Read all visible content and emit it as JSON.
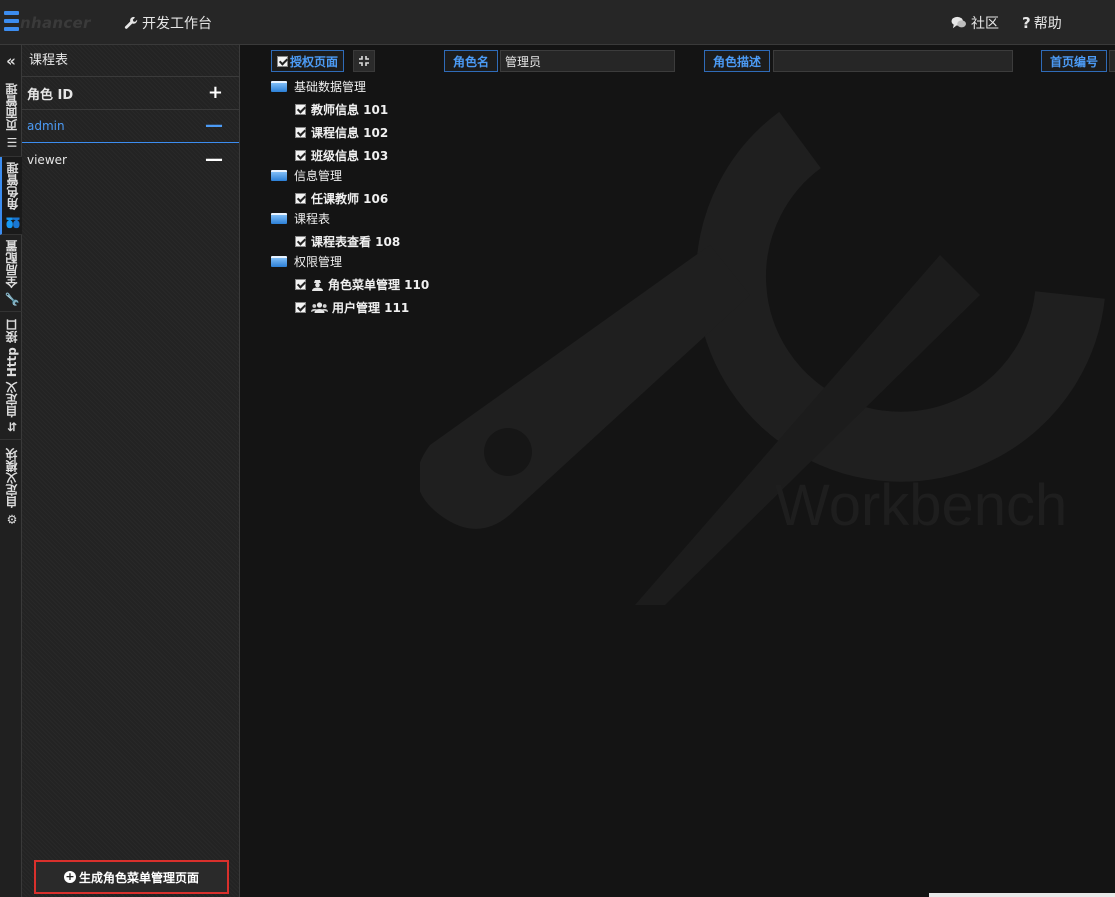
{
  "brand": {
    "logo_text": "nhancer"
  },
  "topbar": {
    "workbench_label": "开发工作台",
    "community_label": "社区",
    "help_label": "帮助"
  },
  "vtabs": [
    {
      "label": "页面管理",
      "icon": "list-icon"
    },
    {
      "label": "角色管理",
      "icon": "users-icon",
      "active": true
    },
    {
      "label": "全局配置",
      "icon": "wrench-icon"
    },
    {
      "label": "自定义 Http 接口",
      "icon": "arrows-icon"
    },
    {
      "label": "自定义模块",
      "icon": "cubes-icon"
    }
  ],
  "sidebar": {
    "title": "课程表",
    "header_label": "角色 ID",
    "roles": [
      {
        "id": "admin",
        "active": true
      },
      {
        "id": "viewer",
        "active": false
      }
    ],
    "generate_button_label": "生成角色菜单管理页面"
  },
  "toolbar": {
    "authorize_label": "授权页面",
    "role_name_label": "角色名",
    "role_name_value": "管理员",
    "role_desc_label": "角色描述",
    "role_desc_value": "",
    "home_no_label": "首页编号"
  },
  "tree": [
    {
      "type": "folder",
      "label": "基础数据管理"
    },
    {
      "type": "leaf",
      "label": "教师信息 101"
    },
    {
      "type": "leaf",
      "label": "课程信息 102"
    },
    {
      "type": "leaf",
      "label": "班级信息 103"
    },
    {
      "type": "folder",
      "label": "信息管理"
    },
    {
      "type": "leaf",
      "label": "任课教师 106"
    },
    {
      "type": "folder",
      "label": "课程表"
    },
    {
      "type": "leaf",
      "label": "课程表查看 108"
    },
    {
      "type": "folder",
      "label": "权限管理"
    },
    {
      "type": "leaf",
      "label": "角色菜单管理 110",
      "icon": "user-secret-icon"
    },
    {
      "type": "leaf",
      "label": "用户管理 111",
      "icon": "users-icon"
    }
  ],
  "watermark_text": "Workbench",
  "colors": {
    "accent": "#3c8df0",
    "highlight_border": "#d9302c",
    "background": "#141414"
  }
}
